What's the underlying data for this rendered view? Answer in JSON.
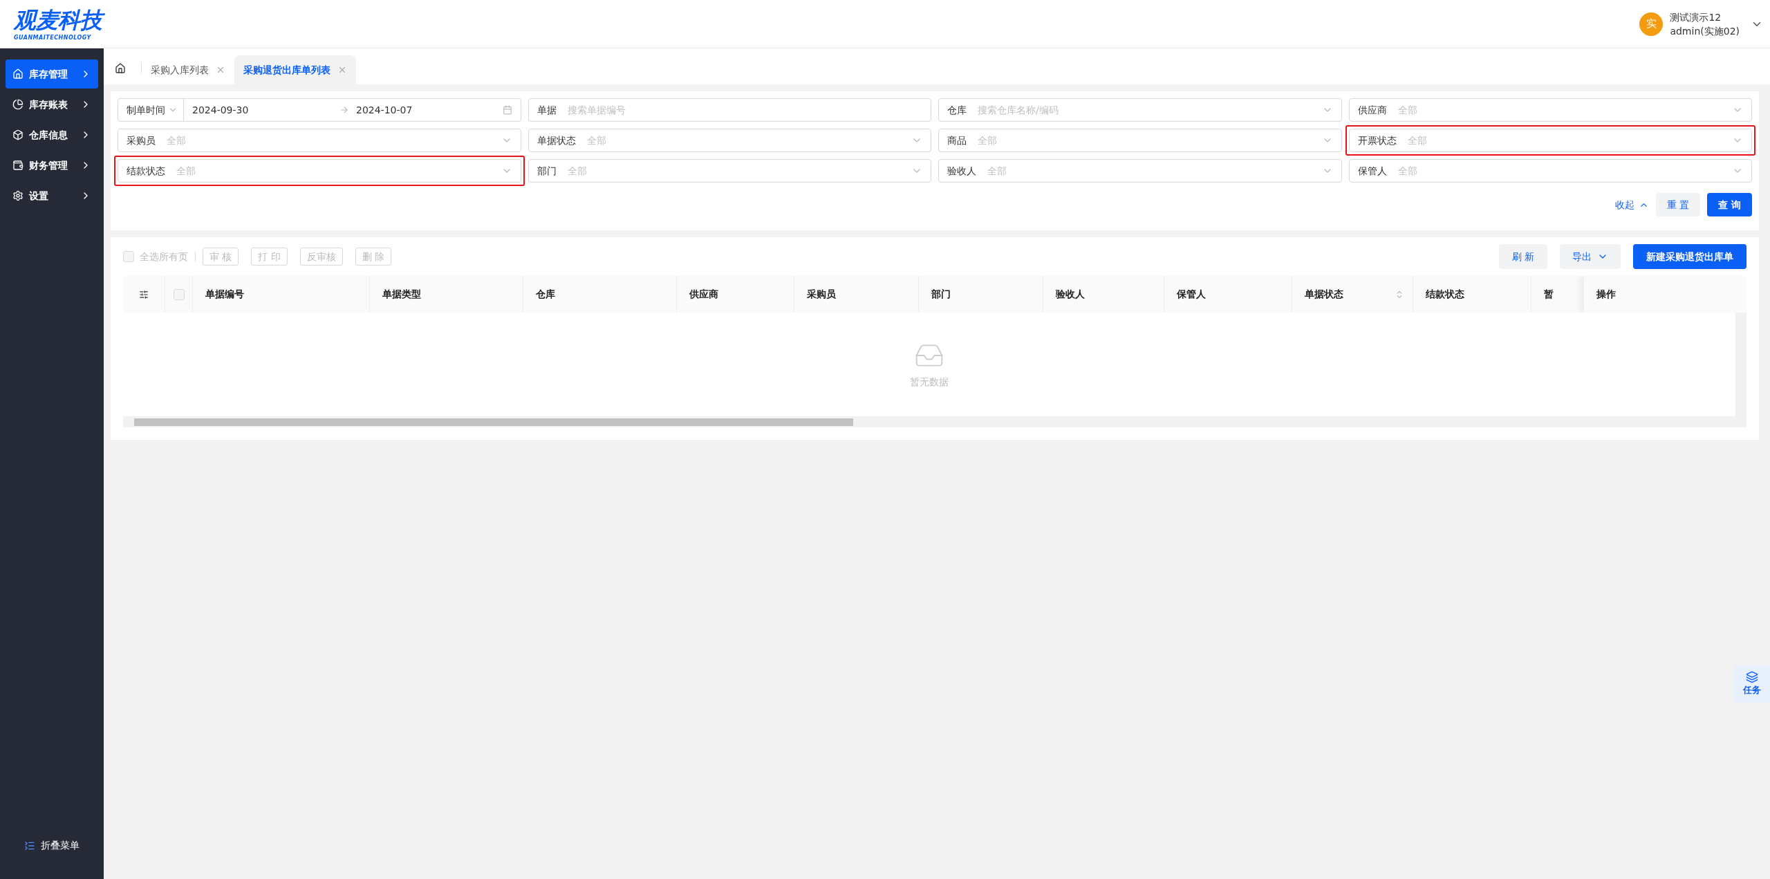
{
  "logo": {
    "name": "观麦科技",
    "tagline": "GUANMAITECHNOLOGY"
  },
  "user": {
    "avatar": "实",
    "name": "测试演示12",
    "account": "admin(实施02)"
  },
  "sidebar": {
    "items": [
      {
        "label": "库存管理",
        "selected": true
      },
      {
        "label": "库存账表",
        "selected": false
      },
      {
        "label": "仓库信息",
        "selected": false
      },
      {
        "label": "财务管理",
        "selected": false
      },
      {
        "label": "设置",
        "selected": false
      }
    ],
    "collapse": "折叠菜单"
  },
  "tabs": [
    {
      "label": "采购入库列表",
      "selected": false
    },
    {
      "label": "采购退货出库单列表",
      "selected": true
    }
  ],
  "filters": [
    {
      "kind": "date_range",
      "label": "制单时间",
      "start": "2024-09-30",
      "end": "2024-10-07",
      "highlighted": false
    },
    {
      "kind": "input",
      "label": "单据",
      "placeholder": "搜索单据编号",
      "highlighted": false
    },
    {
      "kind": "select",
      "label": "仓库",
      "placeholder": "搜索仓库名称/编码",
      "highlighted": false
    },
    {
      "kind": "select",
      "label": "供应商",
      "placeholder": "全部",
      "highlighted": false
    },
    {
      "kind": "select",
      "label": "采购员",
      "placeholder": "全部",
      "highlighted": false
    },
    {
      "kind": "select",
      "label": "单据状态",
      "placeholder": "全部",
      "highlighted": false
    },
    {
      "kind": "select",
      "label": "商品",
      "placeholder": "全部",
      "highlighted": false
    },
    {
      "kind": "select",
      "label": "开票状态",
      "placeholder": "全部",
      "highlighted": true
    },
    {
      "kind": "select",
      "label": "结款状态",
      "placeholder": "全部",
      "highlighted": true
    },
    {
      "kind": "select",
      "label": "部门",
      "placeholder": "全部",
      "highlighted": false
    },
    {
      "kind": "select",
      "label": "验收人",
      "placeholder": "全部",
      "highlighted": false
    },
    {
      "kind": "select",
      "label": "保管人",
      "placeholder": "全部",
      "highlighted": false
    }
  ],
  "filter_actions": {
    "collapse": "收起",
    "reset": "重 置",
    "search": "查 询"
  },
  "toolbar": {
    "select_all": {
      "label": "全选所有页",
      "checked": false
    },
    "actions": [
      {
        "label": "审 核",
        "disabled": true
      },
      {
        "label": "打 印",
        "disabled": true
      },
      {
        "label": "反审核",
        "disabled": true
      },
      {
        "label": "删 除",
        "disabled": true
      }
    ],
    "refresh": "刷 新",
    "export": "导出",
    "create": "新建采购退货出库单"
  },
  "table": {
    "header_checked": false,
    "columns": [
      {
        "label": "单据编号",
        "sortable": false
      },
      {
        "label": "单据类型",
        "sortable": false
      },
      {
        "label": "仓库",
        "sortable": false
      },
      {
        "label": "供应商",
        "sortable": false
      },
      {
        "label": "采购员",
        "sortable": false
      },
      {
        "label": "部门",
        "sortable": false
      },
      {
        "label": "验收人",
        "sortable": false
      },
      {
        "label": "保管人",
        "sortable": false
      },
      {
        "label": "单据状态",
        "sortable": true
      },
      {
        "label": "结款状态",
        "sortable": false
      },
      {
        "label": "暂",
        "sortable": false
      }
    ],
    "action_column": "操作",
    "empty": "暂无数据"
  },
  "task_button": "任务"
}
